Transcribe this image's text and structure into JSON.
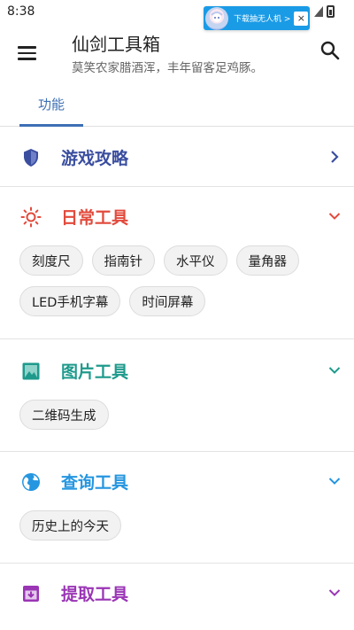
{
  "status_bar": {
    "time": "8:38"
  },
  "ad": {
    "text": "下载抽无人机 >",
    "close": "×"
  },
  "app_bar": {
    "title": "仙剑工具箱",
    "subtitle": "莫笑农家腊酒浑，丰年留客足鸡豚。",
    "menu_icon": "menu-icon",
    "search_icon": "search-icon"
  },
  "tabs": [
    {
      "label": "功能",
      "active": true
    }
  ],
  "colors": {
    "accent": "#3d6fb4",
    "game": "#3a4ea0",
    "daily": "#e24a3c",
    "image": "#1e9a8c",
    "query": "#2596e0",
    "extract": "#9a35b5"
  },
  "sections": [
    {
      "title": "游戏攻略",
      "icon": "shield-icon",
      "expanded": false,
      "chips": []
    },
    {
      "title": "日常工具",
      "icon": "sun-icon",
      "expanded": true,
      "chips": [
        "刻度尺",
        "指南针",
        "水平仪",
        "量角器",
        "LED手机字幕",
        "时间屏幕"
      ]
    },
    {
      "title": "图片工具",
      "icon": "image-icon",
      "expanded": true,
      "chips": [
        "二维码生成"
      ]
    },
    {
      "title": "查询工具",
      "icon": "globe-icon",
      "expanded": true,
      "chips": [
        "历史上的今天"
      ]
    },
    {
      "title": "提取工具",
      "icon": "archive-icon",
      "expanded": true,
      "chips": []
    }
  ]
}
